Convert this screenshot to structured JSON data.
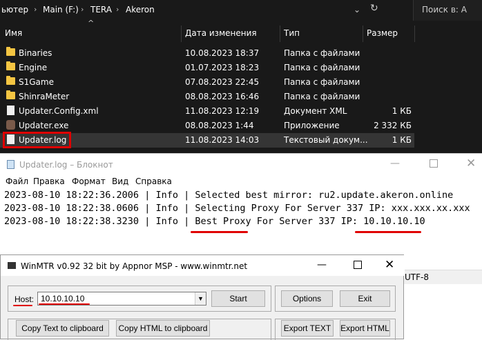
{
  "explorer": {
    "breadcrumb": [
      "ьютер",
      "Main (F:)",
      "TERA",
      "Akeron"
    ],
    "search_placeholder": "Поиск в: А",
    "columns": [
      "Имя",
      "Дата изменения",
      "Тип",
      "Размер"
    ],
    "rows": [
      {
        "name": "Binaries",
        "date": "10.08.2023 18:37",
        "type": "Папка с файлами",
        "size": "",
        "icon": "folder-icon"
      },
      {
        "name": "Engine",
        "date": "01.07.2023 18:23",
        "type": "Папка с файлами",
        "size": "",
        "icon": "folder-icon"
      },
      {
        "name": "S1Game",
        "date": "07.08.2023 22:45",
        "type": "Папка с файлами",
        "size": "",
        "icon": "folder-icon"
      },
      {
        "name": "ShinraMeter",
        "date": "08.08.2023 16:46",
        "type": "Папка с файлами",
        "size": "",
        "icon": "folder-icon"
      },
      {
        "name": "Updater.Config.xml",
        "date": "11.08.2023 12:19",
        "type": "Документ XML",
        "size": "1 КБ",
        "icon": "xml-file-icon"
      },
      {
        "name": "Updater.exe",
        "date": "08.08.2023 1:44",
        "type": "Приложение",
        "size": "2 332 КБ",
        "icon": "exe-icon"
      },
      {
        "name": "Updater.log",
        "date": "11.08.2023 14:03",
        "type": "Текстовый докум...",
        "size": "1 КБ",
        "icon": "text-file-icon"
      }
    ]
  },
  "notepad": {
    "title": "Updater.log – Блокнот",
    "menu": [
      "Файл",
      "Правка",
      "Формат",
      "Вид",
      "Справка"
    ],
    "lines": [
      "2023-08-10 18:22:36.2006 | Info | Selected best mirror: ru2.update.akeron.online",
      "2023-08-10 18:22:38.0606 | Info | Selecting Proxy For Server 337 IP: xxx.xxx.xx.xxx",
      "2023-08-10 18:22:38.3230 | Info | Best Proxy For Server 337 IP: 10.10.10.10"
    ],
    "status_encoding": "UTF-8"
  },
  "winmtr": {
    "title": "WinMTR v0.92 32 bit by Appnor MSP - www.winmtr.net",
    "host_label": "Host:",
    "host_value": "10.10.10.10",
    "start_label": "Start",
    "options_label": "Options",
    "exit_label": "Exit",
    "copy_text_label": "Copy Text to clipboard",
    "copy_html_label": "Copy HTML to clipboard",
    "export_text_label": "Export TEXT",
    "export_html_label": "Export HTML"
  },
  "colors": {
    "highlight_red": "#e00000",
    "folder_yellow": "#f4c542",
    "selected_row": "#353535"
  }
}
